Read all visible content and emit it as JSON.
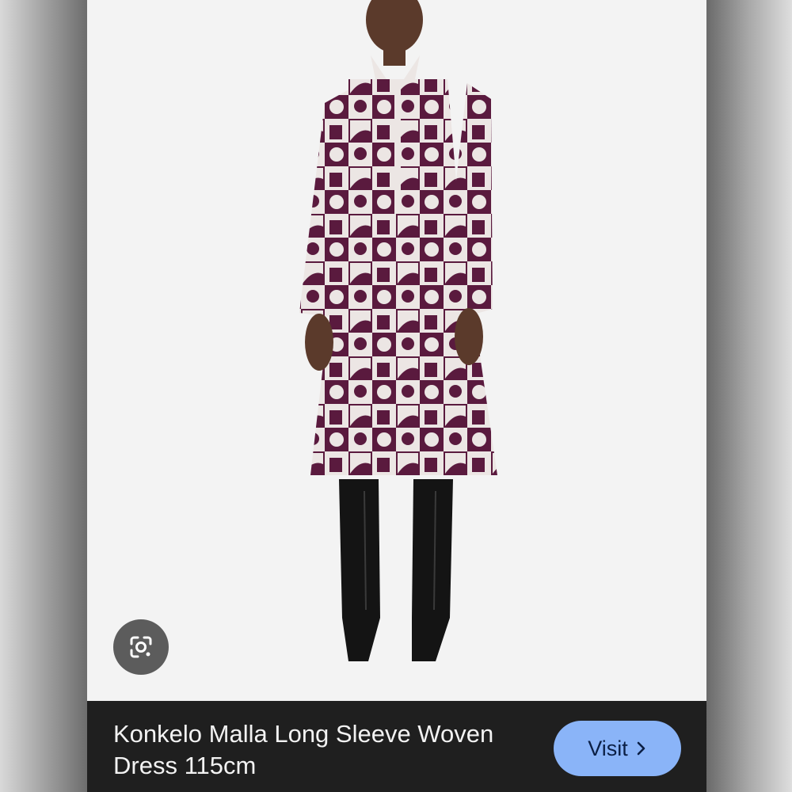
{
  "caption": {
    "title": "Konkelo Malla Long Sleeve Woven Dress 115cm",
    "visit_label": "Visit",
    "visit_icon": "chevron-right-icon"
  },
  "lens": {
    "icon": "google-lens-icon"
  },
  "colors": {
    "caption_background": "#1f1f1f",
    "visit_button": "#8ab4f8",
    "dress_plum": "#5a1a3e",
    "dress_cream": "#ece6e4",
    "boots": "#141414"
  }
}
